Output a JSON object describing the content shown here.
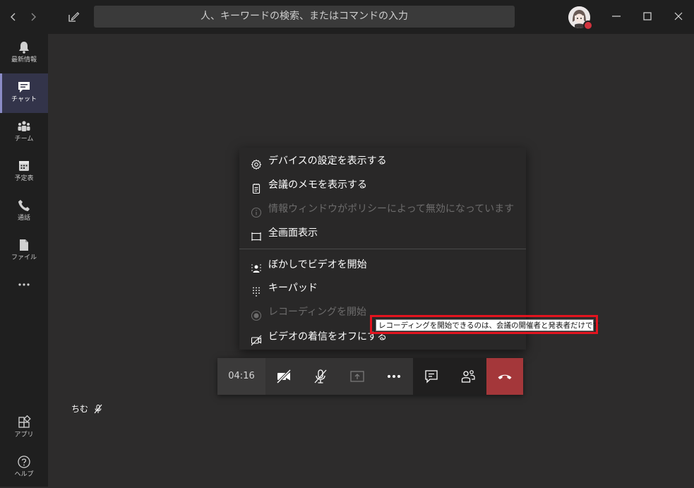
{
  "search": {
    "placeholder": "人、キーワードの検索、またはコマンドの入力"
  },
  "appbar": {
    "items": [
      {
        "label": "最新情報"
      },
      {
        "label": "チャット"
      },
      {
        "label": "チーム"
      },
      {
        "label": "予定表"
      },
      {
        "label": "通話"
      },
      {
        "label": "ファイル"
      },
      {
        "label": ""
      }
    ],
    "bottom": [
      {
        "label": "アプリ"
      },
      {
        "label": "ヘルプ"
      }
    ]
  },
  "menu": {
    "items": [
      {
        "label": "デバイスの設定を表示する",
        "icon": "gear-icon",
        "disabled": false
      },
      {
        "label": "会議のメモを表示する",
        "icon": "notes-icon",
        "disabled": false
      },
      {
        "label": "情報ウィンドウがポリシーによって無効になっています",
        "icon": "info-icon",
        "disabled": true
      },
      {
        "label": "全画面表示",
        "icon": "fullscreen-icon",
        "disabled": false
      },
      {
        "label": "ぼかしでビデオを開始",
        "icon": "blur-icon",
        "disabled": false
      },
      {
        "label": "キーパッド",
        "icon": "keypad-icon",
        "disabled": false
      },
      {
        "label": "レコーディングを開始",
        "icon": "record-icon",
        "disabled": true
      },
      {
        "label": "ビデオの着信をオフにする",
        "icon": "video-off-icon",
        "disabled": false
      }
    ]
  },
  "tooltip": {
    "text": "レコーディングを開始できるのは、会議の開催者と発表者だけです"
  },
  "call": {
    "timer": "04:16"
  },
  "participant": {
    "name": "ちむ"
  },
  "colors": {
    "accent": "#8b8cc7",
    "hangup": "#a4373a",
    "highlight": "#e3141f"
  }
}
